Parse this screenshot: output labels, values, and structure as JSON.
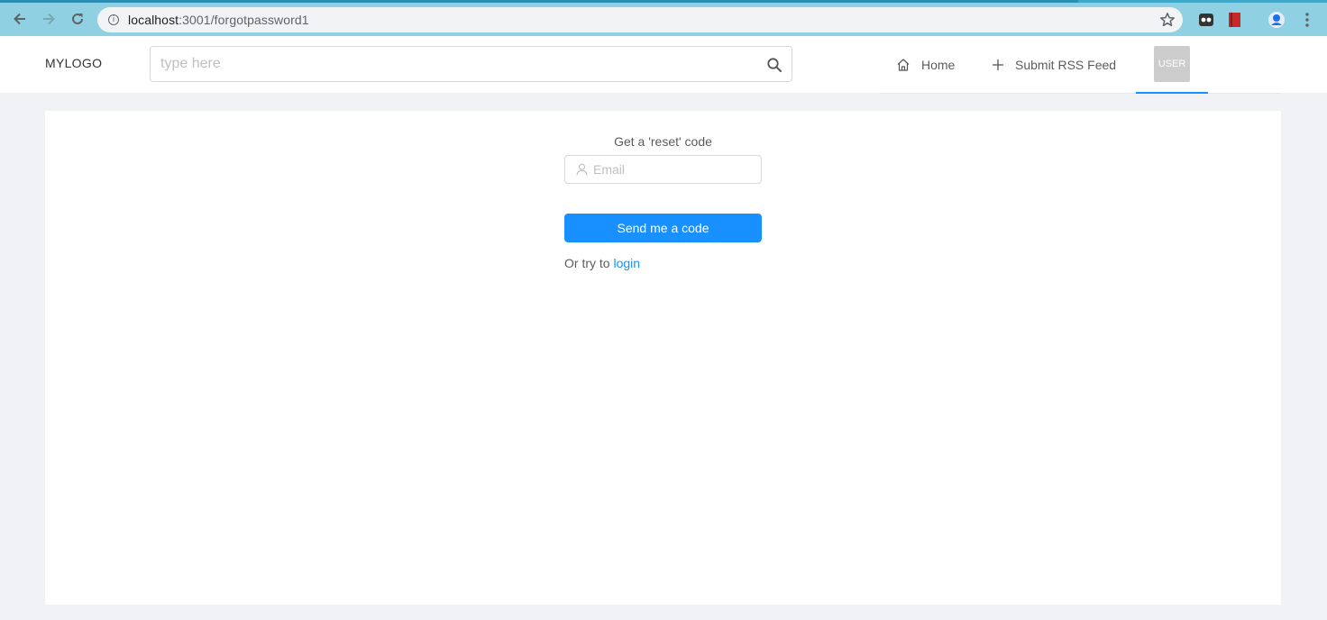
{
  "browser": {
    "url_host": "localhost",
    "url_path": ":3001/forgotpassword1",
    "info_glyph": "i",
    "icons": [
      "back-icon",
      "forward-icon",
      "reload-icon",
      "site-info-icon",
      "bookmark-star-icon",
      "extension-icon",
      "bookmark-extension-icon",
      "profile-icon",
      "menu-kebab-icon"
    ]
  },
  "header": {
    "logo": "MYLOGO",
    "search_placeholder": "type here",
    "menu": {
      "home_label": "Home",
      "submit_label": "Submit RSS Feed",
      "user_label": "USER"
    }
  },
  "form": {
    "title": "Get a 'reset' code",
    "email_placeholder": "Email",
    "submit_label": "Send me a code",
    "alt_prefix": "Or try to",
    "alt_link": "login"
  },
  "colors": {
    "primary": "#1890ff",
    "page_bg": "#f0f2f5",
    "chrome_bg": "#8fd0e2"
  }
}
